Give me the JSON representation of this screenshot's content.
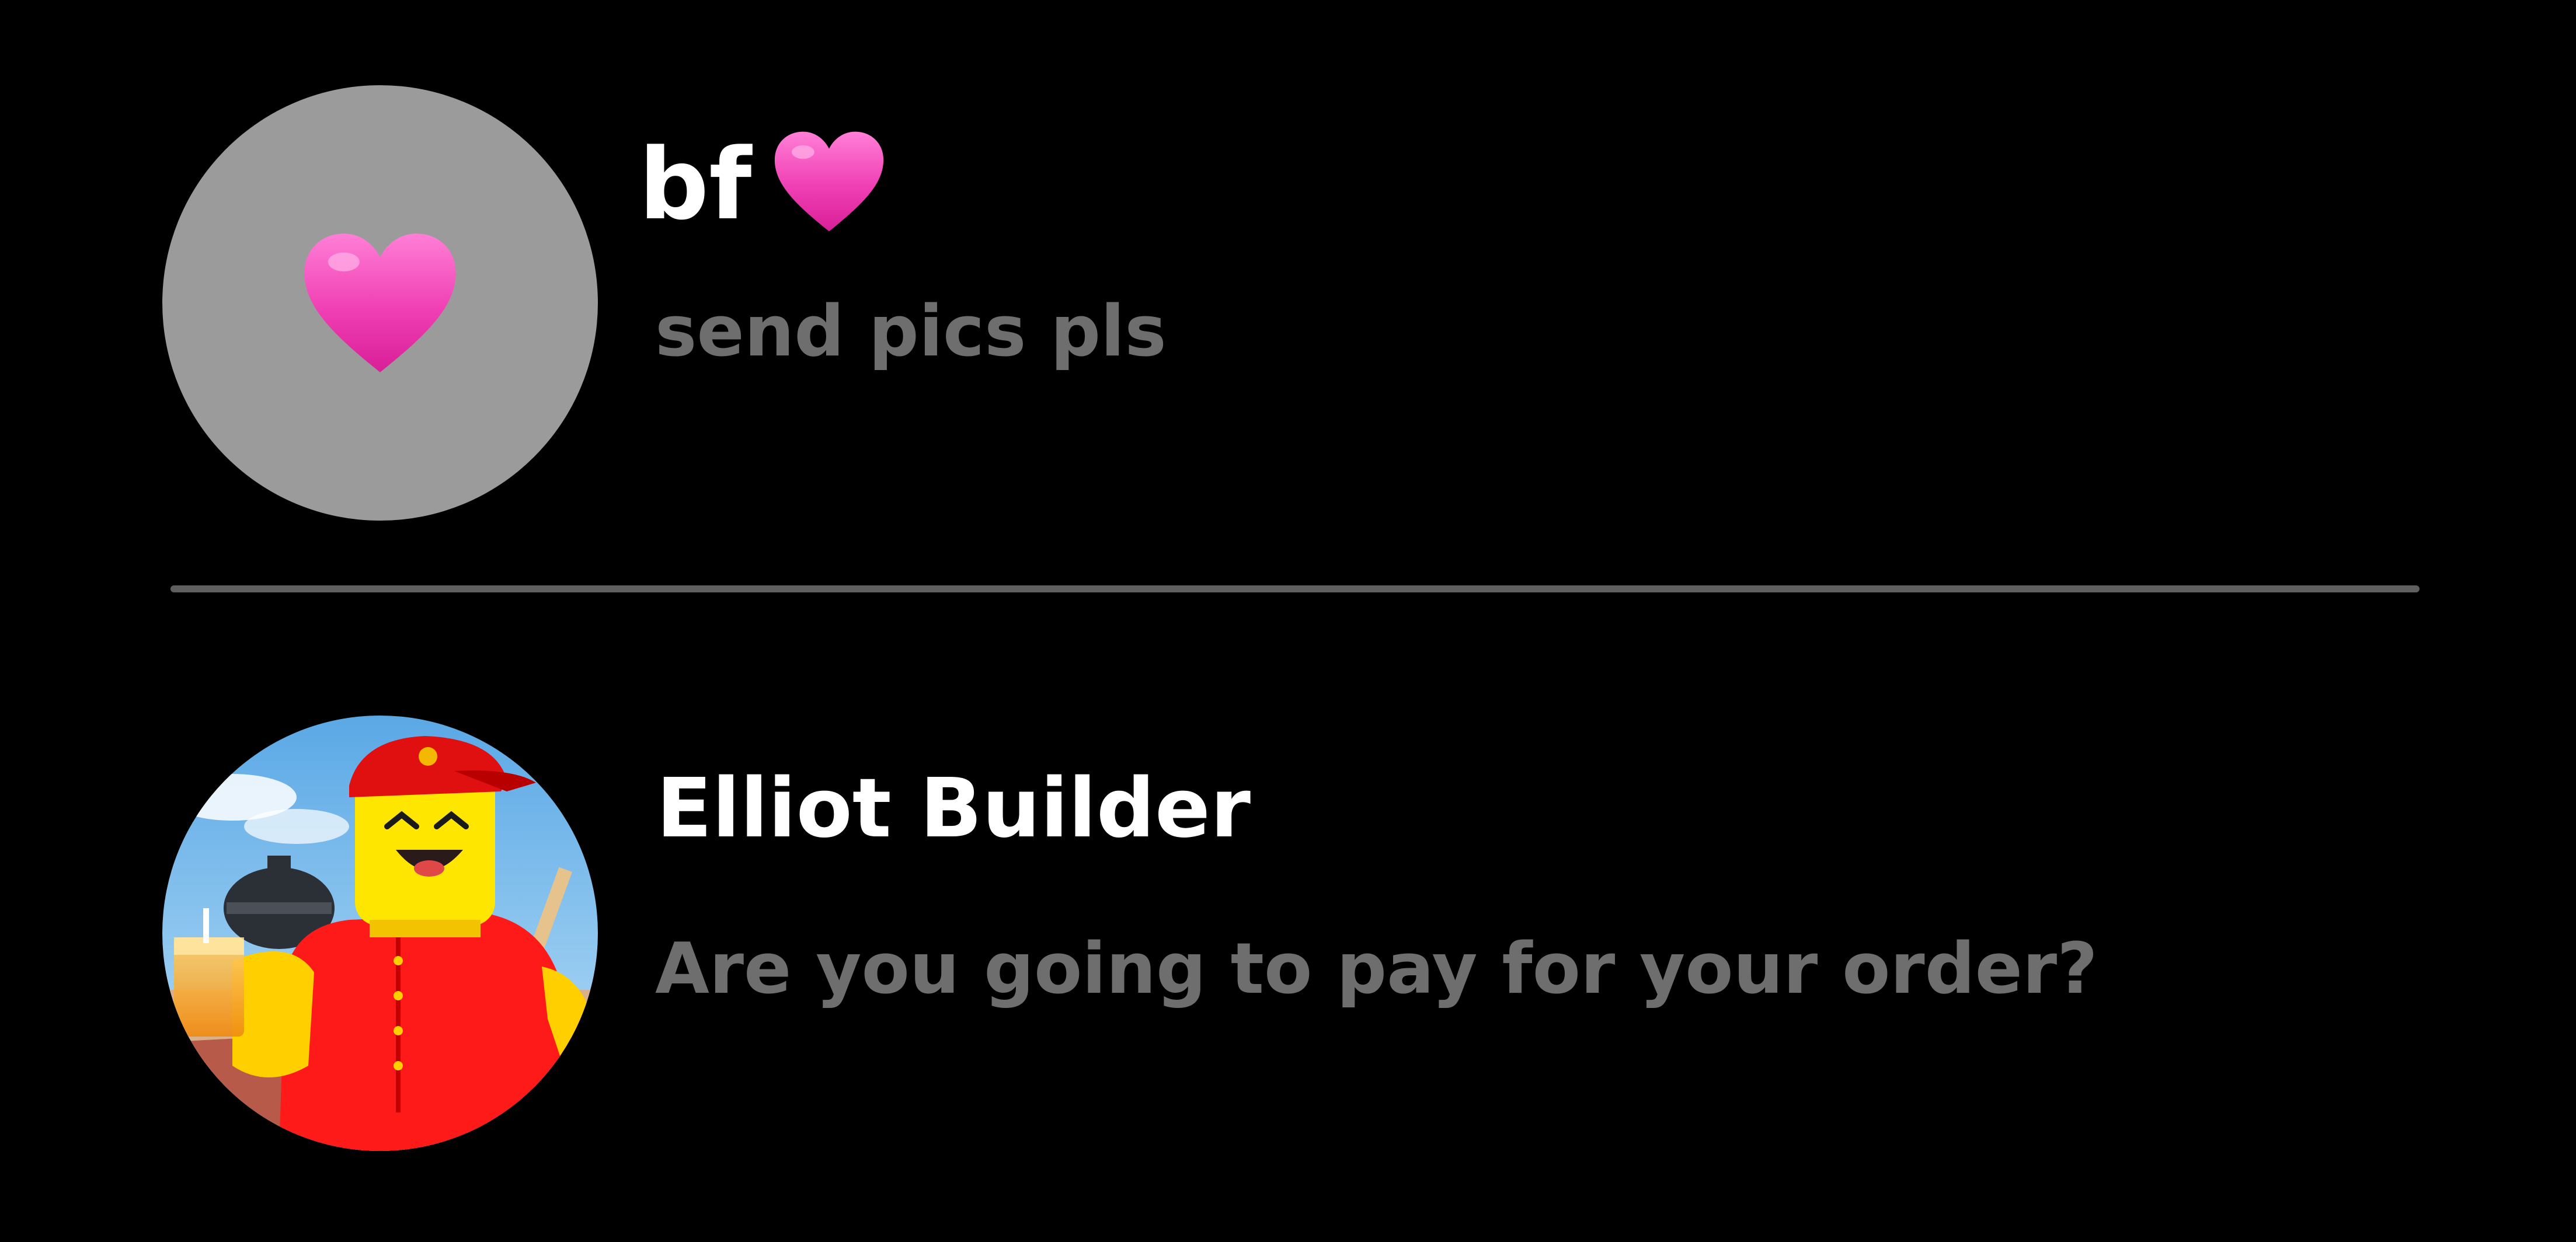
{
  "conversations": [
    {
      "name": "bf",
      "name_emoji": "pink-heart",
      "avatar": "pink-heart-on-grey",
      "preview": "send pics pls"
    },
    {
      "name": "Elliot Builder",
      "avatar": "roblox-character-red-shirt",
      "preview": "Are you going to pay for your order?"
    }
  ],
  "colors": {
    "background": "#000000",
    "name": "#ffffff",
    "preview": "#6e6e6e",
    "divider": "#5f5f5f",
    "heart": "#f03fb4",
    "avatar_grey": "#9b9b9b"
  }
}
